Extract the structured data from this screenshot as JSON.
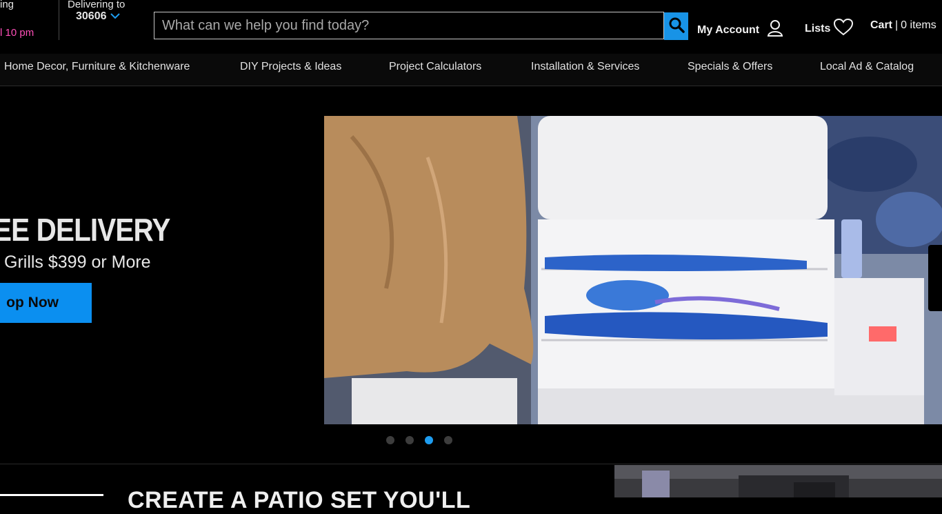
{
  "header": {
    "store_line1": "ing",
    "store_line2": "l 10 pm",
    "delivering_label": "Delivering to",
    "zip": "30606",
    "search_placeholder": "What can we help you find today?",
    "account_label": "My Account",
    "lists_label": "Lists",
    "cart_label": "Cart",
    "cart_separator": "|",
    "cart_items": "0 items"
  },
  "nav": {
    "items": [
      {
        "label": "Home Decor, Furniture & Kitchenware"
      },
      {
        "label": "DIY Projects & Ideas"
      },
      {
        "label": "Project Calculators"
      },
      {
        "label": "Installation & Services"
      },
      {
        "label": "Specials & Offers"
      },
      {
        "label": "Local Ad & Catalog"
      }
    ]
  },
  "hero": {
    "headline": "EE DELIVERY",
    "subtitle": "Grills $399 or More",
    "button_label": "op Now",
    "carousel": {
      "total_slides": 4,
      "active_slide": 3
    }
  },
  "section2": {
    "title": "CREATE A PATIO SET YOU'LL"
  },
  "colors": {
    "accent_blue": "#1893e6",
    "hours_pink": "#ff4fb8",
    "background": "#000000"
  },
  "icons": [
    "chevron-down-icon",
    "search-icon",
    "user-icon",
    "heart-icon",
    "next-arrow-icon"
  ]
}
